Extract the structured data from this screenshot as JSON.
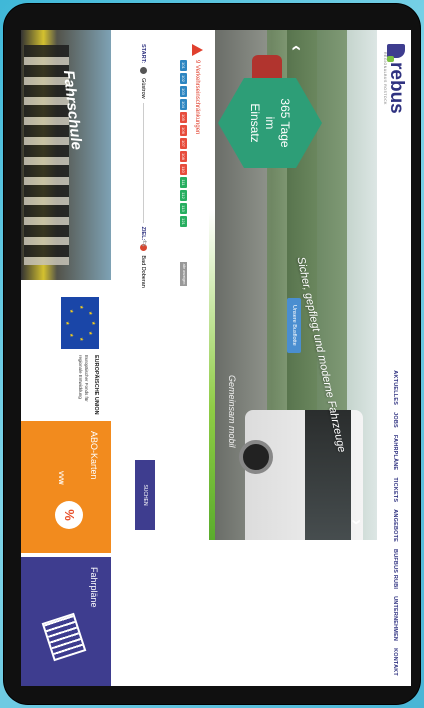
{
  "header": {
    "logo_text": "rebus",
    "logo_sub": "REGIONALBUS ROSTOCK",
    "nav": [
      "AKTUELLES",
      "JOBS",
      "FAHRPLÄNE",
      "TICKETS",
      "ANGEBOTE",
      "BUFBUS RUBI",
      "UNTERNEHMEN",
      "KONTAKT"
    ]
  },
  "hero": {
    "badge": "365 Tage im Einsatz",
    "caption": "Sicher, gepflegt und moderne Fahrzeuge",
    "button": "Unsere Busflotte",
    "slogan": "Gemeinsam mobil"
  },
  "alerts": {
    "text": "9 Verkehrseinschränkungen",
    "chips": [
      "101",
      "102",
      "103",
      "104",
      "105",
      "106",
      "107",
      "108",
      "110",
      "111",
      "112",
      "113",
      "121"
    ],
    "chip_colors": [
      "#2e86c1",
      "#2e86c1",
      "#2e86c1",
      "#2e86c1",
      "#e74c3c",
      "#e74c3c",
      "#e74c3c",
      "#e74c3c",
      "#e74c3c",
      "#27ae60",
      "#27ae60",
      "#27ae60",
      "#27ae60"
    ],
    "more": "alle anzeigen"
  },
  "route": {
    "start_label": "START:",
    "start_value": "Güstrow",
    "ziel_label": "ZIEL:",
    "ziel_value": "Bad Doberan",
    "search": "SUCHEN"
  },
  "tiles": {
    "photo_text": "Fahrschule",
    "eu_title": "EUROPÄISCHE UNION",
    "eu_sub": "Europäischer Fonds für regionale Entwicklung",
    "abo_title": "ABO-Karten",
    "abo_badge": "%",
    "abo_vvw": "VVW",
    "fahr_title": "Fahrpläne"
  }
}
